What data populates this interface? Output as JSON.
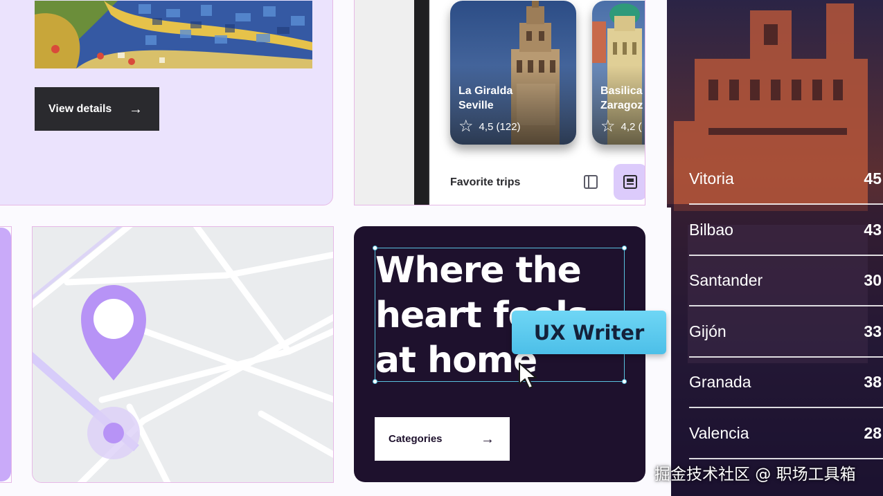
{
  "card_mosaic": {
    "button_label": "View details"
  },
  "card_phone": {
    "trips": [
      {
        "name_line1": "La Giralda",
        "name_line2": "Seville",
        "rating": "4,5 (122)"
      },
      {
        "name_line1": "Basilica",
        "name_line2": "Zaragoz",
        "rating": "4,2 ("
      }
    ],
    "favorites_label": "Favorite trips",
    "icons": [
      "list-view-icon",
      "card-view-icon"
    ]
  },
  "city_list": [
    {
      "name": "Vitoria",
      "value": "45"
    },
    {
      "name": "Bilbao",
      "value": "43"
    },
    {
      "name": "Santander",
      "value": "30"
    },
    {
      "name": "Gijón",
      "value": "33"
    },
    {
      "name": "Granada",
      "value": "38"
    },
    {
      "name": "Valencia",
      "value": "28"
    }
  ],
  "hero": {
    "title": "Where the heart feels at home",
    "tag_label": "UX Writer",
    "button_label": "Categories"
  },
  "watermark": "掘金技术社区 @ 职场工具箱",
  "colors": {
    "lilac": "#ebe3fd",
    "dark": "#2a2a2e",
    "hero_bg": "#1e112d",
    "tag_cyan": "#5fcdef",
    "accent_purple": "#c9aaf9",
    "outline_pink": "#e6b8e6"
  }
}
